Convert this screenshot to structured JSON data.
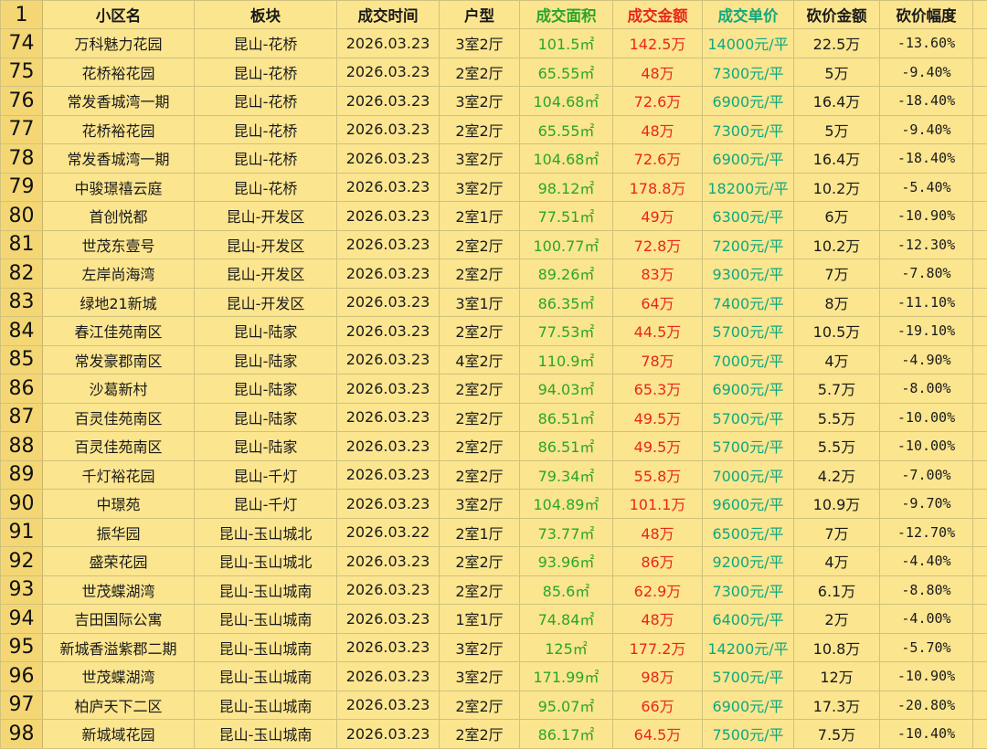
{
  "header": {
    "row_number": "1",
    "columns": [
      "小区名",
      "板块",
      "成交时间",
      "户型",
      "成交面积",
      "成交金额",
      "成交单价",
      "砍价金额",
      "砍价幅度"
    ]
  },
  "rows": [
    {
      "n": "74",
      "name": "万科魅力花园",
      "area": "昆山-花桥",
      "date": "2026.03.23",
      "layout": "3室2厅",
      "size": "101.5㎡",
      "amount": "142.5万",
      "unit": "14000元/平",
      "cut": "22.5万",
      "pct": "-13.60%"
    },
    {
      "n": "75",
      "name": "花桥裕花园",
      "area": "昆山-花桥",
      "date": "2026.03.23",
      "layout": "2室2厅",
      "size": "65.55㎡",
      "amount": "48万",
      "unit": "7300元/平",
      "cut": "5万",
      "pct": "-9.40%"
    },
    {
      "n": "76",
      "name": "常发香城湾一期",
      "area": "昆山-花桥",
      "date": "2026.03.23",
      "layout": "3室2厅",
      "size": "104.68㎡",
      "amount": "72.6万",
      "unit": "6900元/平",
      "cut": "16.4万",
      "pct": "-18.40%"
    },
    {
      "n": "77",
      "name": "花桥裕花园",
      "area": "昆山-花桥",
      "date": "2026.03.23",
      "layout": "2室2厅",
      "size": "65.55㎡",
      "amount": "48万",
      "unit": "7300元/平",
      "cut": "5万",
      "pct": "-9.40%"
    },
    {
      "n": "78",
      "name": "常发香城湾一期",
      "area": "昆山-花桥",
      "date": "2026.03.23",
      "layout": "3室2厅",
      "size": "104.68㎡",
      "amount": "72.6万",
      "unit": "6900元/平",
      "cut": "16.4万",
      "pct": "-18.40%"
    },
    {
      "n": "79",
      "name": "中骏璟禧云庭",
      "area": "昆山-花桥",
      "date": "2026.03.23",
      "layout": "3室2厅",
      "size": "98.12㎡",
      "amount": "178.8万",
      "unit": "18200元/平",
      "cut": "10.2万",
      "pct": "-5.40%"
    },
    {
      "n": "80",
      "name": "首创悦都",
      "area": "昆山-开发区",
      "date": "2026.03.23",
      "layout": "2室1厅",
      "size": "77.51㎡",
      "amount": "49万",
      "unit": "6300元/平",
      "cut": "6万",
      "pct": "-10.90%"
    },
    {
      "n": "81",
      "name": "世茂东壹号",
      "area": "昆山-开发区",
      "date": "2026.03.23",
      "layout": "2室2厅",
      "size": "100.77㎡",
      "amount": "72.8万",
      "unit": "7200元/平",
      "cut": "10.2万",
      "pct": "-12.30%"
    },
    {
      "n": "82",
      "name": "左岸尚海湾",
      "area": "昆山-开发区",
      "date": "2026.03.23",
      "layout": "2室2厅",
      "size": "89.26㎡",
      "amount": "83万",
      "unit": "9300元/平",
      "cut": "7万",
      "pct": "-7.80%"
    },
    {
      "n": "83",
      "name": "绿地21新城",
      "area": "昆山-开发区",
      "date": "2026.03.23",
      "layout": "3室1厅",
      "size": "86.35㎡",
      "amount": "64万",
      "unit": "7400元/平",
      "cut": "8万",
      "pct": "-11.10%"
    },
    {
      "n": "84",
      "name": "春江佳苑南区",
      "area": "昆山-陆家",
      "date": "2026.03.23",
      "layout": "2室2厅",
      "size": "77.53㎡",
      "amount": "44.5万",
      "unit": "5700元/平",
      "cut": "10.5万",
      "pct": "-19.10%"
    },
    {
      "n": "85",
      "name": "常发豪郡南区",
      "area": "昆山-陆家",
      "date": "2026.03.23",
      "layout": "4室2厅",
      "size": "110.9㎡",
      "amount": "78万",
      "unit": "7000元/平",
      "cut": "4万",
      "pct": "-4.90%"
    },
    {
      "n": "86",
      "name": "沙葛新村",
      "area": "昆山-陆家",
      "date": "2026.03.23",
      "layout": "2室2厅",
      "size": "94.03㎡",
      "amount": "65.3万",
      "unit": "6900元/平",
      "cut": "5.7万",
      "pct": "-8.00%"
    },
    {
      "n": "87",
      "name": "百灵佳苑南区",
      "area": "昆山-陆家",
      "date": "2026.03.23",
      "layout": "2室2厅",
      "size": "86.51㎡",
      "amount": "49.5万",
      "unit": "5700元/平",
      "cut": "5.5万",
      "pct": "-10.00%"
    },
    {
      "n": "88",
      "name": "百灵佳苑南区",
      "area": "昆山-陆家",
      "date": "2026.03.23",
      "layout": "2室2厅",
      "size": "86.51㎡",
      "amount": "49.5万",
      "unit": "5700元/平",
      "cut": "5.5万",
      "pct": "-10.00%"
    },
    {
      "n": "89",
      "name": "千灯裕花园",
      "area": "昆山-千灯",
      "date": "2026.03.23",
      "layout": "2室2厅",
      "size": "79.34㎡",
      "amount": "55.8万",
      "unit": "7000元/平",
      "cut": "4.2万",
      "pct": "-7.00%"
    },
    {
      "n": "90",
      "name": "中璟苑",
      "area": "昆山-千灯",
      "date": "2026.03.23",
      "layout": "3室2厅",
      "size": "104.89㎡",
      "amount": "101.1万",
      "unit": "9600元/平",
      "cut": "10.9万",
      "pct": "-9.70%"
    },
    {
      "n": "91",
      "name": "振华园",
      "area": "昆山-玉山城北",
      "date": "2026.03.22",
      "layout": "2室1厅",
      "size": "73.77㎡",
      "amount": "48万",
      "unit": "6500元/平",
      "cut": "7万",
      "pct": "-12.70%"
    },
    {
      "n": "92",
      "name": "盛荣花园",
      "area": "昆山-玉山城北",
      "date": "2026.03.23",
      "layout": "2室2厅",
      "size": "93.96㎡",
      "amount": "86万",
      "unit": "9200元/平",
      "cut": "4万",
      "pct": "-4.40%"
    },
    {
      "n": "93",
      "name": "世茂蝶湖湾",
      "area": "昆山-玉山城南",
      "date": "2026.03.23",
      "layout": "2室2厅",
      "size": "85.6㎡",
      "amount": "62.9万",
      "unit": "7300元/平",
      "cut": "6.1万",
      "pct": "-8.80%"
    },
    {
      "n": "94",
      "name": "吉田国际公寓",
      "area": "昆山-玉山城南",
      "date": "2026.03.23",
      "layout": "1室1厅",
      "size": "74.84㎡",
      "amount": "48万",
      "unit": "6400元/平",
      "cut": "2万",
      "pct": "-4.00%"
    },
    {
      "n": "95",
      "name": "新城香溢紫郡二期",
      "area": "昆山-玉山城南",
      "date": "2026.03.23",
      "layout": "3室2厅",
      "size": "125㎡",
      "amount": "177.2万",
      "unit": "14200元/平",
      "cut": "10.8万",
      "pct": "-5.70%"
    },
    {
      "n": "96",
      "name": "世茂蝶湖湾",
      "area": "昆山-玉山城南",
      "date": "2026.03.23",
      "layout": "3室2厅",
      "size": "171.99㎡",
      "amount": "98万",
      "unit": "5700元/平",
      "cut": "12万",
      "pct": "-10.90%"
    },
    {
      "n": "97",
      "name": "柏庐天下二区",
      "area": "昆山-玉山城南",
      "date": "2026.03.23",
      "layout": "2室2厅",
      "size": "95.07㎡",
      "amount": "66万",
      "unit": "6900元/平",
      "cut": "17.3万",
      "pct": "-20.80%"
    },
    {
      "n": "98",
      "name": "新城域花园",
      "area": "昆山-玉山城南",
      "date": "2026.03.23",
      "layout": "2室2厅",
      "size": "86.17㎡",
      "amount": "64.5万",
      "unit": "7500元/平",
      "cut": "7.5万",
      "pct": "-10.40%"
    }
  ],
  "colors": {
    "background": "#fbe58f",
    "row_header": "#f4d774",
    "size_green": "#2aa52a",
    "amount_red": "#e8271b",
    "unit_teal": "#0fa87e"
  }
}
